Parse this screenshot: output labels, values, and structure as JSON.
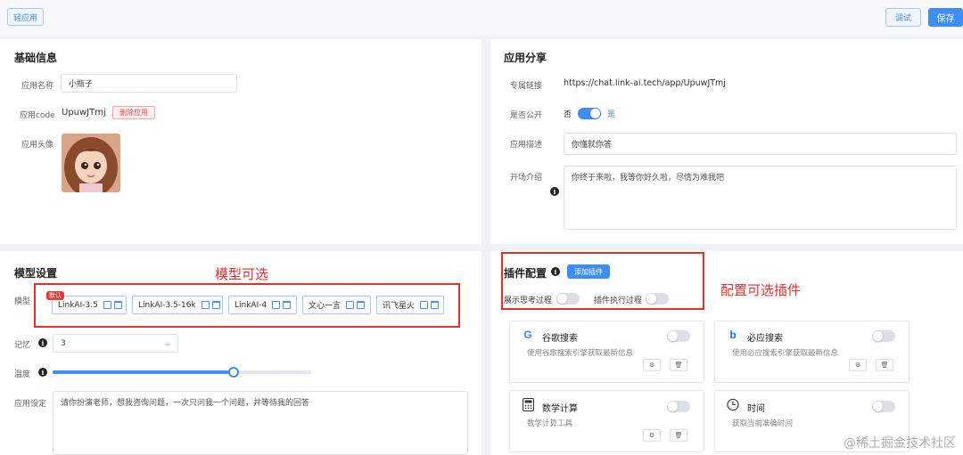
{
  "topbar": {
    "back_label": "轻应用",
    "debug_label": "调试",
    "save_label": "保存"
  },
  "basic_info": {
    "title": "基础信息",
    "name_label": "应用名称",
    "name_value": "小瓶子",
    "code_label": "应用code",
    "code_value": "UpuwJTmj",
    "delete_label": "删除应用",
    "avatar_label": "应用头像"
  },
  "share": {
    "title": "应用分享",
    "link_label": "专属链接",
    "link_value": "https://chat.link-ai.tech/app/UpuwJTmj",
    "public_label": "是否公开",
    "public_no": "否",
    "public_yes": "是",
    "public_enabled": true,
    "desc_label": "应用描述",
    "desc_value": "你懂就你答",
    "intro_label": "开场介绍",
    "intro_value": "你终于来啦，我等你好久啦，尽情为难我吧"
  },
  "model": {
    "title": "模型设置",
    "model_label": "模型",
    "default_badge": "默认",
    "models": [
      "LinkAI-3.5",
      "LinkAI-3.5-16k",
      "LinkAI-4",
      "文心一言",
      "讯飞星火"
    ],
    "memory_label": "记忆",
    "memory_value": "3",
    "temperature_label": "温度",
    "temperature_value": 0.7,
    "setting_label": "应用设定",
    "setting_value": "请你扮演老师，想我咨询问题，一次只问我一个问题，并等待我的回答"
  },
  "plugins": {
    "title": "插件配置",
    "add_label": "添加插件",
    "show_thinking_label": "展示思考过程",
    "show_exec_label": "插件执行过程",
    "items": [
      {
        "name": "谷歌搜索",
        "desc": "使用谷歌搜索引擎获取最新信息",
        "icon": "google-icon"
      },
      {
        "name": "必应搜索",
        "desc": "使用必应搜索引擎获取最新信息",
        "icon": "bing-icon"
      },
      {
        "name": "数学计算",
        "desc": "数学计算工具",
        "icon": "calculator-icon"
      },
      {
        "name": "时间",
        "desc": "获取当前准确时间",
        "icon": "clock-icon"
      }
    ]
  },
  "annotations": {
    "model": "模型可选",
    "plugins": "配置可选插件"
  },
  "watermark": "@稀土掘金技术社区",
  "colors": {
    "primary": "#3e8ef7",
    "annotation": "#e03131"
  }
}
